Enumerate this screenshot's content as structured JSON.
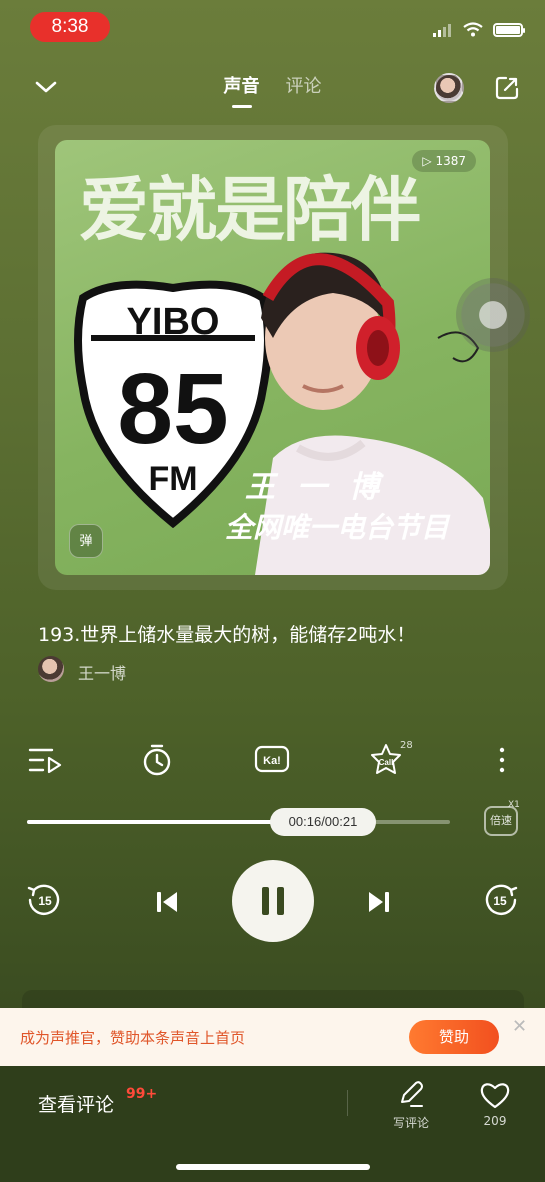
{
  "status_bar": {
    "time": "8:38"
  },
  "header": {
    "tabs": [
      {
        "label": "声音",
        "active": true
      },
      {
        "label": "评论",
        "active": false
      }
    ],
    "icons": [
      "chevron-down-icon",
      "avatar",
      "share-icon"
    ]
  },
  "cover": {
    "title": "爱就是陪伴",
    "play_count": "1387",
    "shield_top": "YIBO",
    "shield_number": "85",
    "shield_bottom": "FM",
    "host": "王一博",
    "program_label": "全网唯一电台节目",
    "badge": "弹"
  },
  "episode": {
    "title": "193.世界上储水量最大的树，能储存2吨水！",
    "author": "王一博"
  },
  "functions": {
    "icons": [
      "playlist-icon",
      "timer-icon",
      "ka-icon",
      "call-icon",
      "more-icon"
    ],
    "ka_label": "Ka!",
    "call_label": "Call",
    "call_count": "28"
  },
  "progress": {
    "time_display": "00:16/00:21",
    "fraction": 0.74,
    "speed_label": "倍速",
    "speed_value": "X1"
  },
  "controls": {
    "rewind_label": "15",
    "forward_label": "15"
  },
  "banner": {
    "text": "成为声推官，赞助本条声音上首页",
    "button": "赞助"
  },
  "bottom": {
    "view_comments": "查看评论",
    "comment_count": "99+",
    "write_comment": "写评论",
    "likes": "209"
  },
  "colors": {
    "background_top": "#6b7d3b",
    "background_bottom": "#31401c",
    "accent": "#f2501f",
    "time_pill": "#e8302b",
    "cover_green": "#86b460"
  }
}
